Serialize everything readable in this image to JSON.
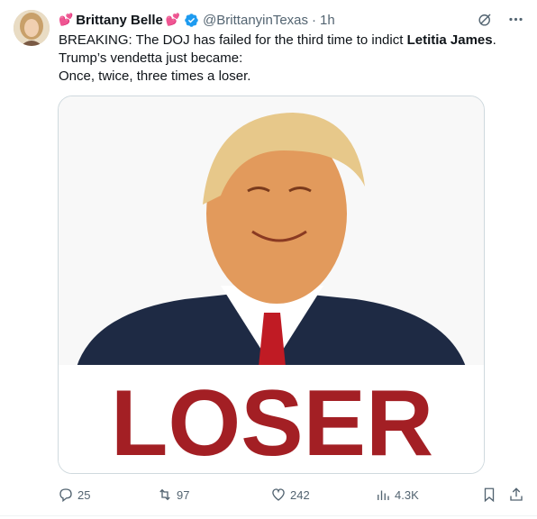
{
  "author": {
    "name": "Brittany Belle",
    "handle": "@BrittanyinTexas",
    "time": "1h",
    "separator": "·",
    "heart_left": "💕",
    "heart_right": "💕"
  },
  "post": {
    "line1_before": "BREAKING: The DOJ has failed for the third time to indict ",
    "line1_bold": "Letitia James",
    "line1_after": ".",
    "line2": "Trump’s vendetta just became:",
    "line3": "Once, twice, three times a loser."
  },
  "media": {
    "caption": "LOSER"
  },
  "stats": {
    "replies": "25",
    "reposts": "97",
    "likes": "242",
    "views": "4.3K"
  },
  "colors": {
    "verified": "#1d9bf0",
    "loser_text": "#a31f24",
    "muted": "#536471"
  },
  "icons": {
    "grok": "grok-icon",
    "more": "more-icon",
    "reply": "reply-icon",
    "repost": "repost-icon",
    "like": "like-icon",
    "views": "views-icon",
    "bookmark": "bookmark-icon",
    "share": "share-icon"
  }
}
